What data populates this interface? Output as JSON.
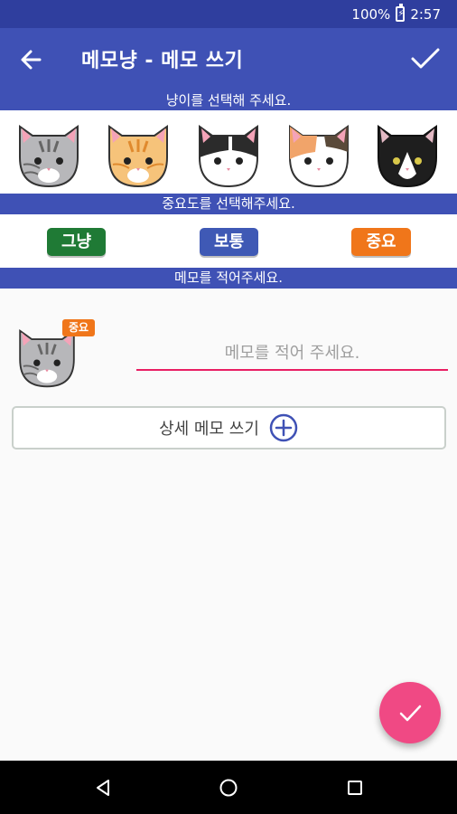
{
  "status_bar": {
    "battery": "100%",
    "time": "2:57"
  },
  "app_bar": {
    "title": "메모냥 - 메모 쓰기",
    "back_icon": "arrow-back-icon",
    "confirm_icon": "check-icon"
  },
  "sections": {
    "cat_label": "냥이를 선택해 주세요.",
    "importance_label": "중요도를 선택해주세요.",
    "memo_label": "메모를 적어주세요."
  },
  "cats": [
    {
      "name": "gray-tabby",
      "color": "#b7b7ba"
    },
    {
      "name": "orange-tabby",
      "color": "#f6c37a"
    },
    {
      "name": "black-white",
      "color": "#2b2b2b"
    },
    {
      "name": "calico",
      "color": "#f1a46a"
    },
    {
      "name": "tuxedo",
      "color": "#1e1e1e"
    }
  ],
  "importance": {
    "normal_label": "그냥",
    "normal_color": "#1f7a35",
    "medium_label": "보통",
    "medium_color": "#3f59b5",
    "high_label": "중요",
    "high_color": "#f0761a"
  },
  "memo": {
    "badge": "중요",
    "placeholder": "메모를 적어 주세요.",
    "value": "",
    "detail_button_label": "상세 메모 쓰기",
    "accent_color": "#e91e63"
  },
  "fab": {
    "icon": "check-icon",
    "color": "#f04984"
  },
  "nav_bar": {
    "back_icon": "nav-back-icon",
    "home_icon": "nav-home-icon",
    "recents_icon": "nav-recents-icon"
  }
}
